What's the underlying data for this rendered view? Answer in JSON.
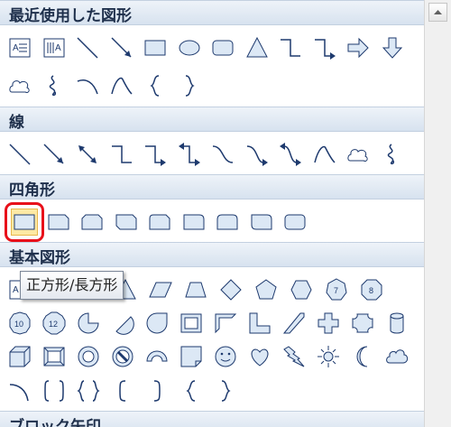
{
  "categories": {
    "recent": "最近使用した図形",
    "lines": "線",
    "rectangles": "四角形",
    "basic": "基本図形",
    "block_arrows": "ブロック矢印"
  },
  "tooltip": "正方形/長方形",
  "colors": {
    "accent": "#1e3a6e",
    "fill": "#dce8f5",
    "selection": "#e8101a",
    "header_bg": "#dbe5f1"
  }
}
